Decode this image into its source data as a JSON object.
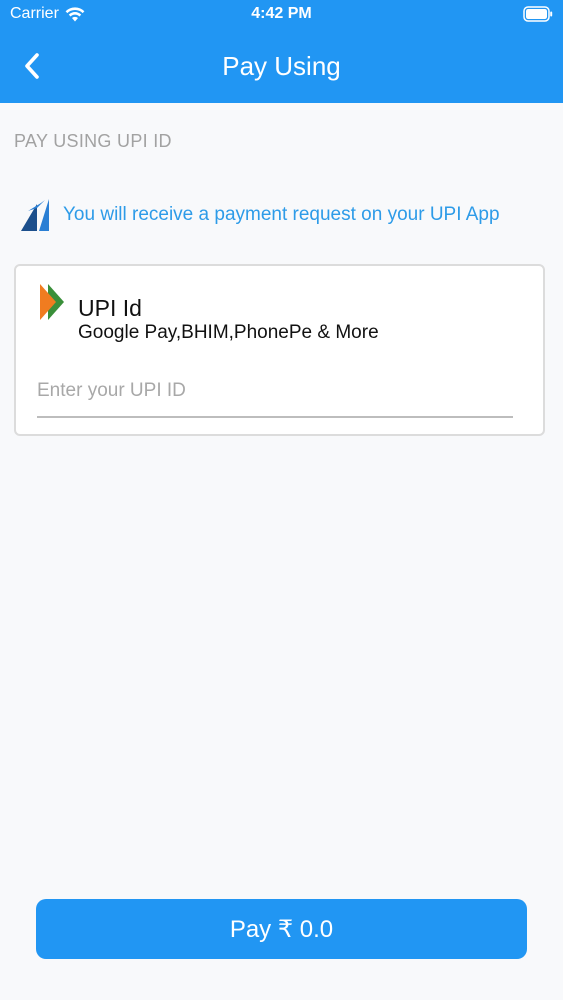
{
  "status_bar": {
    "carrier": "Carrier",
    "time": "4:42 PM",
    "wifi_icon": "wifi-icon",
    "battery_icon": "battery-icon"
  },
  "header": {
    "title": "Pay Using",
    "back_icon": "chevron-left-icon"
  },
  "section": {
    "label": "PAY USING UPI ID"
  },
  "info": {
    "icon": "payment-app-logo-icon",
    "text": "You will receive a payment request on your UPI App"
  },
  "upi_card": {
    "logo_icon": "upi-logo-icon",
    "title": "UPI Id",
    "subtitle": "Google Pay,BHIM,PhonePe & More",
    "input_value": "",
    "input_placeholder": "Enter your UPI ID"
  },
  "pay_button": {
    "label": "Pay ₹ 0.0"
  },
  "colors": {
    "primary": "#2196f3",
    "info_text": "#2d9be8",
    "background": "#f8f9fb",
    "muted": "#a2a2a2"
  }
}
